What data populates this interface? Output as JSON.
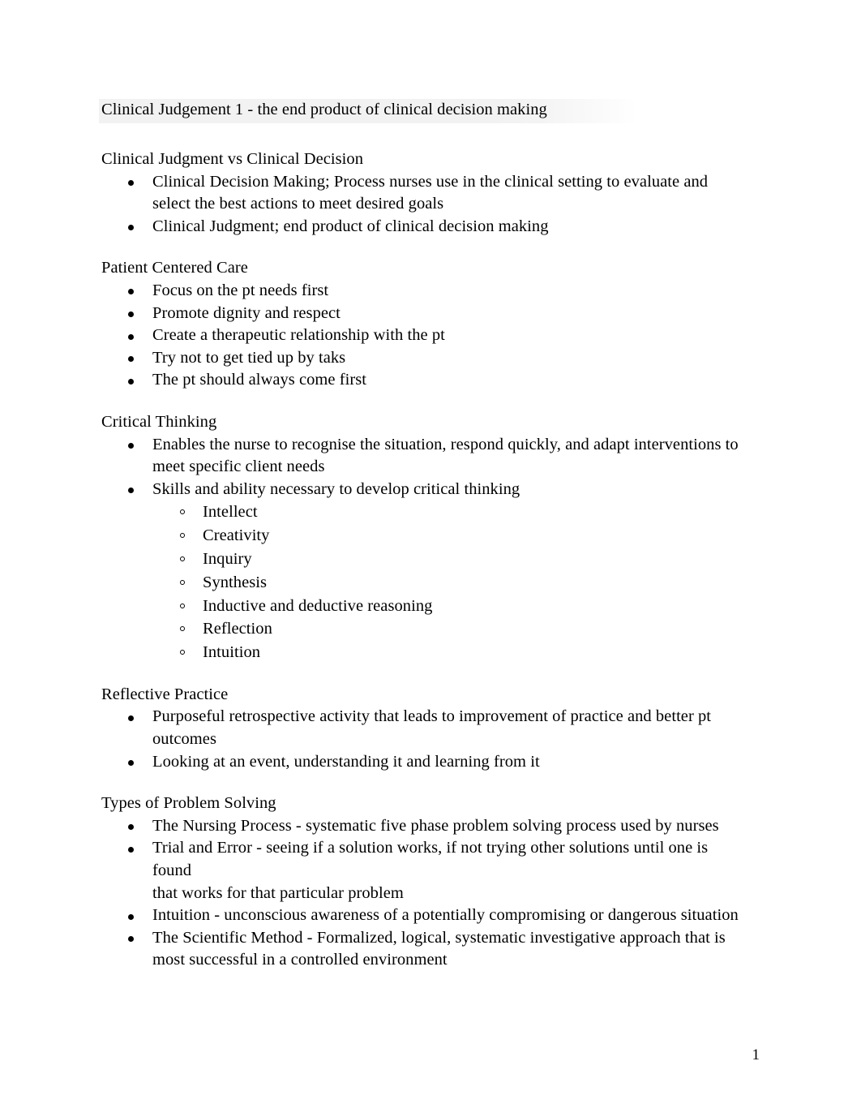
{
  "document": {
    "title": "Clinical Judgement 1 - the end product of clinical decision making",
    "page_number": "1",
    "highlight_color": "#f2f2f2"
  },
  "sections": [
    {
      "heading": "Clinical Judgment vs Clinical Decision",
      "bullets": [
        {
          "text": "Clinical Decision Making; Process nurses use in the clinical setting to evaluate and select the best actions to meet desired goals"
        },
        {
          "text": "Clinical Judgment; end product of clinical decision making"
        }
      ]
    },
    {
      "heading": "Patient Centered Care",
      "bullets": [
        {
          "text": "Focus on the pt needs first"
        },
        {
          "text": "Promote dignity and respect"
        },
        {
          "text": "Create a therapeutic relationship with the pt"
        },
        {
          "text": "Try not to get tied up by taks"
        },
        {
          "text": "The pt should always come first"
        }
      ]
    },
    {
      "heading": "Critical Thinking",
      "bullets": [
        {
          "text": "Enables the nurse to recognise the situation, respond quickly, and adapt interventions to meet specific client needs"
        },
        {
          "text": "Skills and ability necessary to develop critical thinking",
          "subbullets": [
            "Intellect",
            "Creativity",
            "Inquiry",
            "Synthesis",
            "Inductive and deductive reasoning",
            "Reflection",
            "Intuition"
          ]
        }
      ]
    },
    {
      "heading": "Reflective Practice",
      "bullets": [
        {
          "text": "Purposeful retrospective activity that leads to improvement of practice and better pt outcomes"
        },
        {
          "text": "Looking at an event, understanding it and learning from it"
        }
      ]
    },
    {
      "heading": "Types of Problem Solving",
      "bullets": [
        {
          "text": "The Nursing Process - systematic five phase problem solving process used by nurses"
        },
        {
          "text": "Trial and Error - seeing if a solution works, if not trying other solutions until one is found",
          "continuation": "that works for that particular problem"
        },
        {
          "text": "Intuition - unconscious awareness of a potentially compromising or dangerous situation"
        },
        {
          "text": "The Scientific Method - Formalized, logical, systematic investigative approach that is most successful in a controlled environment"
        }
      ]
    }
  ]
}
